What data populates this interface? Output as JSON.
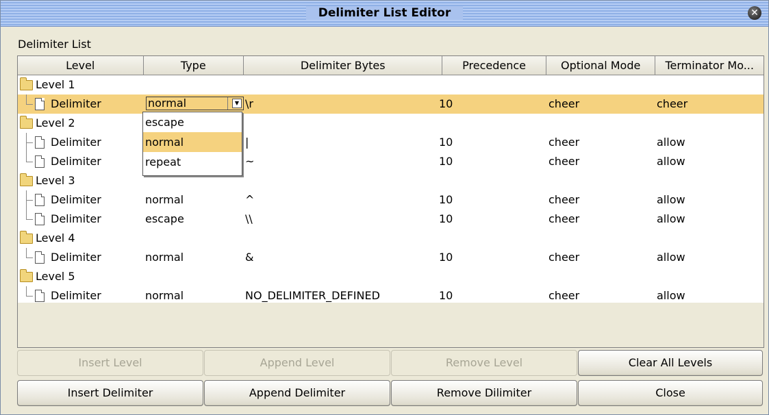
{
  "window": {
    "title": "Delimiter List Editor",
    "close_glyph": "✕"
  },
  "list": {
    "caption": "Delimiter List",
    "columns": [
      "Level",
      "Type",
      "Delimiter Bytes",
      "Precedence",
      "Optional Mode",
      "Terminator Mo..."
    ]
  },
  "rows": [
    {
      "kind": "level",
      "label": "Level 1"
    },
    {
      "kind": "delim",
      "label": "Delimiter",
      "type": "normal",
      "bytes": "\\r",
      "precedence": "10",
      "optional": "cheer",
      "terminator": "cheer",
      "selected": true
    },
    {
      "kind": "level",
      "label": "Level 2"
    },
    {
      "kind": "delim",
      "label": "Delimiter",
      "type": "",
      "bytes": "|",
      "precedence": "10",
      "optional": "cheer",
      "terminator": "allow"
    },
    {
      "kind": "delim",
      "label": "Delimiter",
      "type": "",
      "bytes": "~",
      "precedence": "10",
      "optional": "cheer",
      "terminator": "allow"
    },
    {
      "kind": "level",
      "label": "Level 3"
    },
    {
      "kind": "delim",
      "label": "Delimiter",
      "type": "normal",
      "bytes": "^",
      "precedence": "10",
      "optional": "cheer",
      "terminator": "allow"
    },
    {
      "kind": "delim",
      "label": "Delimiter",
      "type": "escape",
      "bytes": "\\\\",
      "precedence": "10",
      "optional": "cheer",
      "terminator": "allow"
    },
    {
      "kind": "level",
      "label": "Level 4"
    },
    {
      "kind": "delim",
      "label": "Delimiter",
      "type": "normal",
      "bytes": "&",
      "precedence": "10",
      "optional": "cheer",
      "terminator": "allow"
    },
    {
      "kind": "level",
      "label": "Level 5"
    },
    {
      "kind": "delim",
      "label": "Delimiter",
      "type": "normal",
      "bytes": "NO_DELIMITER_DEFINED",
      "precedence": "10",
      "optional": "cheer",
      "terminator": "allow"
    }
  ],
  "type_editor": {
    "value": "normal",
    "options": [
      "escape",
      "normal",
      "repeat"
    ],
    "highlighted": "normal"
  },
  "buttons": {
    "insert_level": "Insert Level",
    "append_level": "Append Level",
    "remove_level": "Remove Level",
    "clear_all_levels": "Clear All Levels",
    "insert_delimiter": "Insert Delimiter",
    "append_delimiter": "Append Delimiter",
    "remove_delimiter": "Remove Dilimiter",
    "close": "Close"
  },
  "colors": {
    "selection": "#f5d27f",
    "title_bar": "#a9c2ee",
    "panel": "#ece9d8"
  }
}
